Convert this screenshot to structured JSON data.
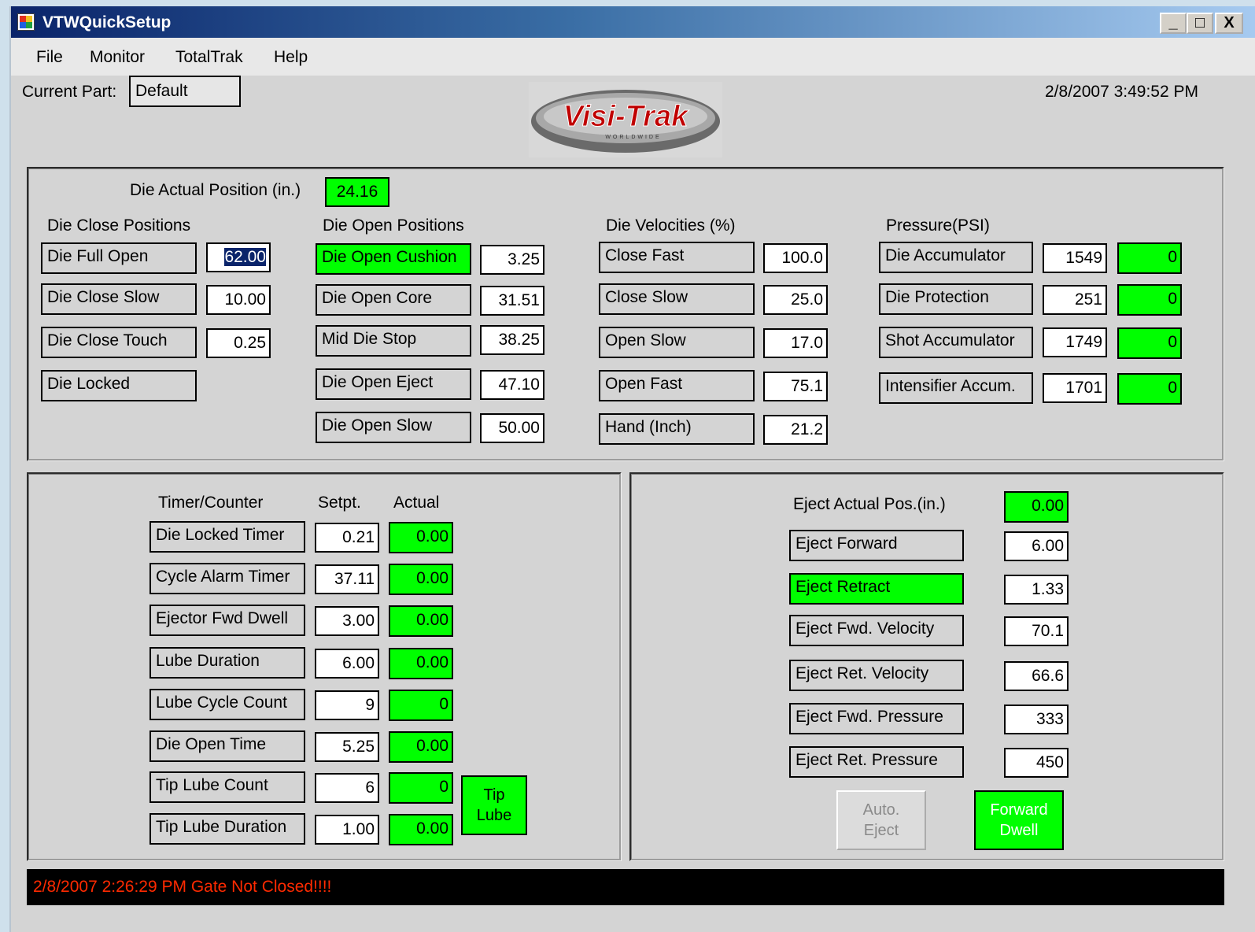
{
  "window": {
    "title": "VTWQuickSetup",
    "min": "_",
    "max": "□",
    "close": "X"
  },
  "menu": [
    "File",
    "Monitor",
    "TotalTrak",
    "Help"
  ],
  "header": {
    "current_part_label": "Current Part:",
    "current_part_value": "Default",
    "datetime": "2/8/2007 3:49:52 PM",
    "logo_text": "Visi-Trak",
    "logo_sub": "WORLDWIDE"
  },
  "die": {
    "actual_label": "Die Actual Position (in.)",
    "actual_value": "24.16",
    "close_heading": "Die Close Positions",
    "close": [
      {
        "label": "Die Full Open",
        "value": "62.00"
      },
      {
        "label": "Die Close Slow",
        "value": "10.00"
      },
      {
        "label": "Die Close Touch",
        "value": "0.25"
      },
      {
        "label": "Die Locked",
        "value": ""
      }
    ],
    "open_heading": "Die Open Positions",
    "open": [
      {
        "label": "Die Open Cushion",
        "value": "3.25"
      },
      {
        "label": "Die Open Core",
        "value": "31.51"
      },
      {
        "label": "Mid Die Stop",
        "value": "38.25"
      },
      {
        "label": "Die Open Eject",
        "value": "47.10"
      },
      {
        "label": "Die Open Slow",
        "value": "50.00"
      }
    ],
    "vel_heading": "Die Velocities (%)",
    "vel": [
      {
        "label": "Close Fast",
        "value": "100.0"
      },
      {
        "label": "Close Slow",
        "value": "25.0"
      },
      {
        "label": "Open Slow",
        "value": "17.0"
      },
      {
        "label": "Open Fast",
        "value": "75.1"
      },
      {
        "label": "Hand (Inch)",
        "value": "21.2"
      }
    ],
    "pres_heading": "Pressure(PSI)",
    "pres": [
      {
        "label": "Die Accumulator",
        "value": "1549",
        "actual": "0"
      },
      {
        "label": "Die Protection",
        "value": "251",
        "actual": "0"
      },
      {
        "label": "Shot Accumulator",
        "value": "1749",
        "actual": "0"
      },
      {
        "label": "Intensifier Accum.",
        "value": "1701",
        "actual": "0"
      }
    ]
  },
  "timers": {
    "col_name": "Timer/Counter",
    "col_setpt": "Setpt.",
    "col_actual": "Actual",
    "rows": [
      {
        "label": "Die Locked Timer",
        "setpt": "0.21",
        "actual": "0.00"
      },
      {
        "label": "Cycle Alarm Timer",
        "setpt": "37.11",
        "actual": "0.00"
      },
      {
        "label": "Ejector Fwd Dwell",
        "setpt": "3.00",
        "actual": "0.00"
      },
      {
        "label": "Lube Duration",
        "setpt": "6.00",
        "actual": "0.00"
      },
      {
        "label": "Lube Cycle Count",
        "setpt": "9",
        "actual": "0"
      },
      {
        "label": "Die Open Time",
        "setpt": "5.25",
        "actual": "0.00"
      },
      {
        "label": "Tip Lube Count",
        "setpt": "6",
        "actual": "0"
      },
      {
        "label": "Tip Lube Duration",
        "setpt": "1.00",
        "actual": "0.00"
      }
    ],
    "tip_lube_button": [
      "Tip",
      "Lube"
    ]
  },
  "eject": {
    "actual_label": "Eject Actual Pos.(in.)",
    "actual_value": "0.00",
    "rows": [
      {
        "label": "Eject Forward",
        "value": "6.00"
      },
      {
        "label": "Eject Retract",
        "value": "1.33"
      },
      {
        "label": "Eject Fwd. Velocity",
        "value": "70.1"
      },
      {
        "label": "Eject Ret. Velocity",
        "value": "66.6"
      },
      {
        "label": "Eject Fwd. Pressure",
        "value": "333"
      },
      {
        "label": "Eject Ret. Pressure",
        "value": "450"
      }
    ],
    "auto_eject_button": [
      "Auto.",
      "Eject"
    ],
    "forward_dwell_button": [
      "Forward",
      "Dwell"
    ]
  },
  "status_message": "2/8/2007 2:26:29 PM Gate Not Closed!!!!",
  "colors": {
    "active_green": "#00ff00",
    "status_text": "#ff2a00",
    "titlebar": "#0a246a"
  }
}
